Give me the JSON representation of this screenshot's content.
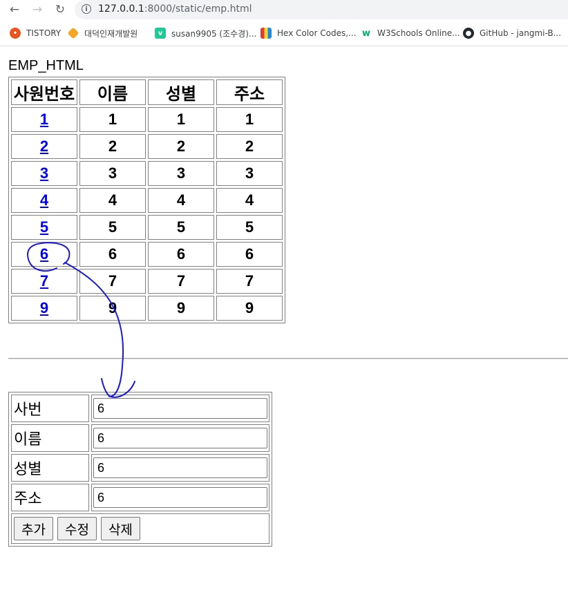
{
  "browser": {
    "url_host": "127.0.0.1",
    "url_path": ":8000/static/emp.html",
    "bookmarks": [
      {
        "label": "TISTORY",
        "icon": "tistory-icon",
        "color": "#eb531f"
      },
      {
        "label": "대덕인재개발원",
        "icon": "daedeok-logo-icon",
        "color": "#f5a623"
      },
      {
        "label": "susan9905 (조수경)...",
        "icon": "velog-icon",
        "color": "#20c997"
      },
      {
        "label": "Hex Color Codes,...",
        "icon": "color-book-icon",
        "color": "#4a6cd4"
      },
      {
        "label": "W3Schools Online...",
        "icon": "w3schools-icon",
        "color": "#04aa6d"
      },
      {
        "label": "GitHub - jangmi-B...",
        "icon": "github-icon",
        "color": "#24292e"
      }
    ]
  },
  "page": {
    "title": "EMP_HTML",
    "table": {
      "headers": [
        "사원번호",
        "이름",
        "성별",
        "주소"
      ],
      "rows": [
        {
          "id": "1",
          "name": "1",
          "gender": "1",
          "addr": "1"
        },
        {
          "id": "2",
          "name": "2",
          "gender": "2",
          "addr": "2"
        },
        {
          "id": "3",
          "name": "3",
          "gender": "3",
          "addr": "3"
        },
        {
          "id": "4",
          "name": "4",
          "gender": "4",
          "addr": "4"
        },
        {
          "id": "5",
          "name": "5",
          "gender": "5",
          "addr": "5"
        },
        {
          "id": "6",
          "name": "6",
          "gender": "6",
          "addr": "6"
        },
        {
          "id": "7",
          "name": "7",
          "gender": "7",
          "addr": "7"
        },
        {
          "id": "9",
          "name": "9",
          "gender": "9",
          "addr": "9"
        }
      ]
    },
    "form": {
      "fields": [
        {
          "label": "사번",
          "value": "6"
        },
        {
          "label": "이름",
          "value": "6"
        },
        {
          "label": "성별",
          "value": "6"
        },
        {
          "label": "주소",
          "value": "6"
        }
      ],
      "buttons": {
        "add": "추가",
        "edit": "수정",
        "delete": "삭제"
      }
    }
  },
  "annotation_color": "#1a1ad6",
  "link_color": "#0000ee"
}
